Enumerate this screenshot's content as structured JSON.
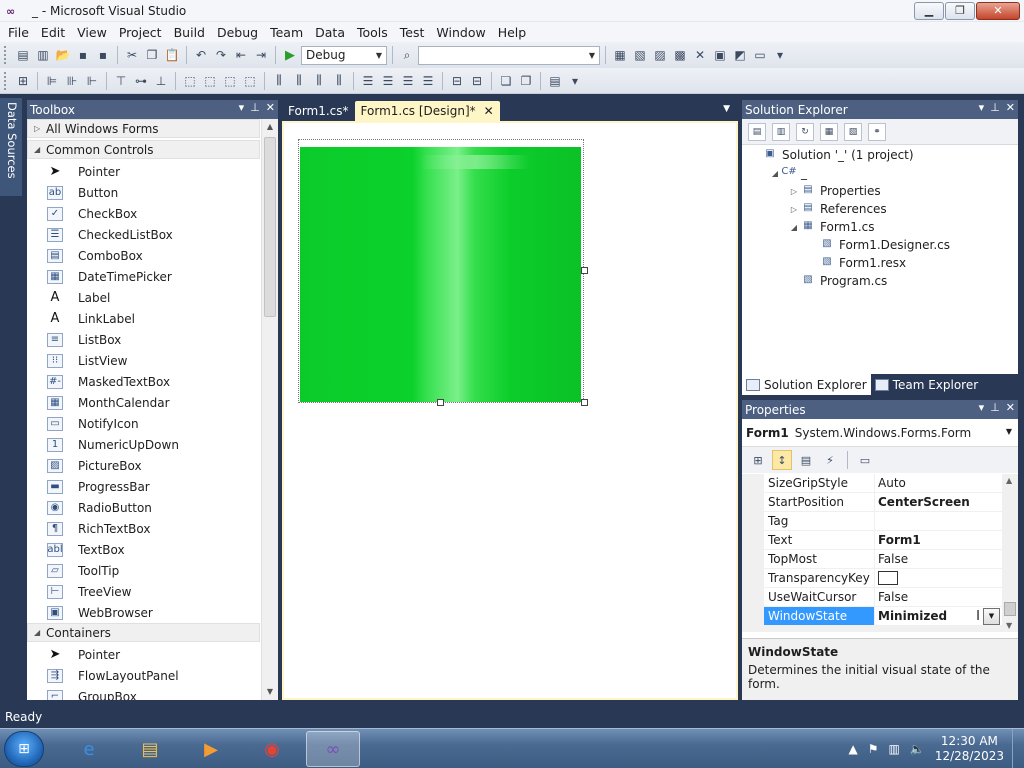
{
  "window": {
    "title": "_ - Microsoft Visual Studio",
    "controls": [
      "minimize-icon",
      "maximize-icon",
      "close-icon"
    ]
  },
  "menu": [
    "File",
    "Edit",
    "View",
    "Project",
    "Build",
    "Debug",
    "Team",
    "Data",
    "Tools",
    "Test",
    "Window",
    "Help"
  ],
  "toolbar": {
    "config_value": "Debug",
    "platform_value": ""
  },
  "side_strip": {
    "label": "Data Sources"
  },
  "toolbox": {
    "title": "Toolbox",
    "groups": [
      {
        "label": "All Windows Forms",
        "expanded": false,
        "items": []
      },
      {
        "label": "Common Controls",
        "expanded": true,
        "items": [
          {
            "label": "Pointer",
            "icon": "pointer-icon",
            "glyph": "➤"
          },
          {
            "label": "Button",
            "icon": "button-icon",
            "glyph": "ab"
          },
          {
            "label": "CheckBox",
            "icon": "checkbox-icon",
            "glyph": "✓"
          },
          {
            "label": "CheckedListBox",
            "icon": "checked-listbox-icon",
            "glyph": "☰"
          },
          {
            "label": "ComboBox",
            "icon": "combobox-icon",
            "glyph": "▤"
          },
          {
            "label": "DateTimePicker",
            "icon": "datetimepicker-icon",
            "glyph": "▦"
          },
          {
            "label": "Label",
            "icon": "label-icon",
            "glyph": "A"
          },
          {
            "label": "LinkLabel",
            "icon": "linklabel-icon",
            "glyph": "A"
          },
          {
            "label": "ListBox",
            "icon": "listbox-icon",
            "glyph": "≡"
          },
          {
            "label": "ListView",
            "icon": "listview-icon",
            "glyph": "⁝⁝"
          },
          {
            "label": "MaskedTextBox",
            "icon": "maskedtextbox-icon",
            "glyph": "#-"
          },
          {
            "label": "MonthCalendar",
            "icon": "monthcalendar-icon",
            "glyph": "▦"
          },
          {
            "label": "NotifyIcon",
            "icon": "notifyicon-icon",
            "glyph": "▭"
          },
          {
            "label": "NumericUpDown",
            "icon": "numericupdown-icon",
            "glyph": "1"
          },
          {
            "label": "PictureBox",
            "icon": "picturebox-icon",
            "glyph": "▨"
          },
          {
            "label": "ProgressBar",
            "icon": "progressbar-icon",
            "glyph": "▬"
          },
          {
            "label": "RadioButton",
            "icon": "radiobutton-icon",
            "glyph": "◉"
          },
          {
            "label": "RichTextBox",
            "icon": "richtextbox-icon",
            "glyph": "¶"
          },
          {
            "label": "TextBox",
            "icon": "textbox-icon",
            "glyph": "abl"
          },
          {
            "label": "ToolTip",
            "icon": "tooltip-icon",
            "glyph": "▱"
          },
          {
            "label": "TreeView",
            "icon": "treeview-icon",
            "glyph": "⊢"
          },
          {
            "label": "WebBrowser",
            "icon": "webbrowser-icon",
            "glyph": "▣"
          }
        ]
      },
      {
        "label": "Containers",
        "expanded": true,
        "items": [
          {
            "label": "Pointer",
            "icon": "pointer-icon",
            "glyph": "➤"
          },
          {
            "label": "FlowLayoutPanel",
            "icon": "flowlayoutpanel-icon",
            "glyph": "⇶"
          },
          {
            "label": "GroupBox",
            "icon": "groupbox-icon",
            "glyph": "⌐"
          }
        ]
      }
    ]
  },
  "doc_tabs": [
    {
      "label": "Form1.cs*",
      "active": false
    },
    {
      "label": "Form1.cs [Design]*",
      "active": true
    }
  ],
  "designer": {
    "form_gradient": [
      "#0bcb2a",
      "#7af08a"
    ]
  },
  "solution_explorer": {
    "title": "Solution Explorer",
    "tree": [
      {
        "label": "Solution '_' (1 project)",
        "level": 0,
        "exp": "",
        "icon": "solution-icon",
        "glyph": "▣"
      },
      {
        "label": "_",
        "level": 1,
        "exp": "◢",
        "icon": "csharp-project-icon",
        "glyph": "C#"
      },
      {
        "label": "Properties",
        "level": 2,
        "exp": "▷",
        "icon": "properties-folder-icon",
        "glyph": "▤"
      },
      {
        "label": "References",
        "level": 2,
        "exp": "▷",
        "icon": "references-icon",
        "glyph": "▤"
      },
      {
        "label": "Form1.cs",
        "level": 2,
        "exp": "◢",
        "icon": "form-file-icon",
        "glyph": "▦"
      },
      {
        "label": "Form1.Designer.cs",
        "level": 3,
        "exp": "",
        "icon": "cs-file-icon",
        "glyph": "▧"
      },
      {
        "label": "Form1.resx",
        "level": 3,
        "exp": "",
        "icon": "resx-file-icon",
        "glyph": "▧"
      },
      {
        "label": "Program.cs",
        "level": 2,
        "exp": "",
        "icon": "cs-file-icon",
        "glyph": "▧"
      }
    ],
    "tabs": [
      {
        "label": "Solution Explorer",
        "active": true
      },
      {
        "label": "Team Explorer",
        "active": false
      }
    ]
  },
  "properties": {
    "title": "Properties",
    "object_name": "Form1",
    "object_type": "System.Windows.Forms.Form",
    "rows": [
      {
        "name": "SizeGripStyle",
        "value": "Auto",
        "bold": false
      },
      {
        "name": "StartPosition",
        "value": "CenterScreen",
        "bold": true
      },
      {
        "name": "Tag",
        "value": "",
        "bold": false
      },
      {
        "name": "Text",
        "value": "Form1",
        "bold": true
      },
      {
        "name": "TopMost",
        "value": "False",
        "bold": false
      },
      {
        "name": "TransparencyKey",
        "value": "",
        "bold": false,
        "swatch": "#ffffff"
      },
      {
        "name": "UseWaitCursor",
        "value": "False",
        "bold": false
      },
      {
        "name": "WindowState",
        "value": "Minimized",
        "bold": true,
        "selected": true
      }
    ],
    "description_title": "WindowState",
    "description_text": "Determines the initial visual state of the form."
  },
  "status": {
    "text": "Ready"
  },
  "taskbar": {
    "apps": [
      {
        "name": "internet-explorer-icon",
        "glyph": "e",
        "color": "#3a8ee6"
      },
      {
        "name": "file-explorer-icon",
        "glyph": "▤",
        "color": "#f0c050"
      },
      {
        "name": "media-player-icon",
        "glyph": "▶",
        "color": "#f39c33"
      },
      {
        "name": "chrome-icon",
        "glyph": "◉",
        "color": "#e94235"
      },
      {
        "name": "visual-studio-icon",
        "glyph": "∞",
        "color": "#7a4fb5"
      }
    ],
    "time": "12:30 AM",
    "date": "12/28/2023"
  }
}
